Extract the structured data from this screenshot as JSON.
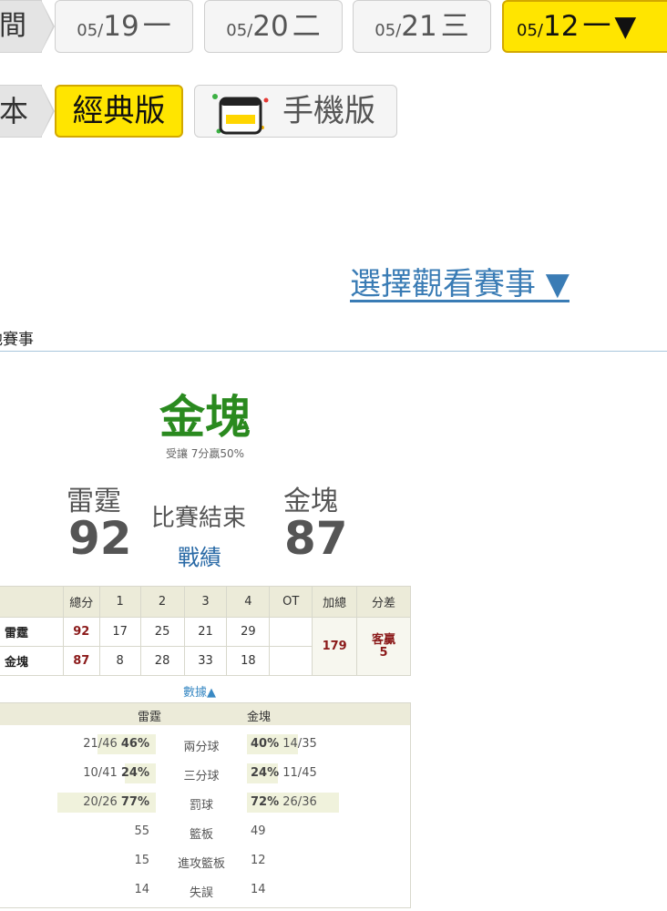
{
  "date_nav": {
    "label": "間",
    "dates": [
      {
        "md": "05/",
        "day": "19",
        "weekday": "一"
      },
      {
        "md": "05/",
        "day": "20",
        "weekday": "二"
      },
      {
        "md": "05/",
        "day": "21",
        "weekday": "三"
      }
    ],
    "selected": {
      "md": "05/",
      "day": "12",
      "weekday": "一",
      "arrow": "▼"
    }
  },
  "version_nav": {
    "label": "本",
    "classic": "經典版",
    "mobile": "手機版"
  },
  "select_match": "選擇觀看賽事 ▼",
  "other_games": "他賽事",
  "game": {
    "winner": "金塊",
    "handicap_note": "受讓 7分贏50%",
    "away_name": "雷霆",
    "away_score": "92",
    "home_name": "金塊",
    "home_score": "87",
    "status": "比賽結束",
    "record_link": "戰績"
  },
  "quarter_table": {
    "headers": [
      "總分",
      "1",
      "2",
      "3",
      "4",
      "OT",
      "加總",
      "分差"
    ],
    "rows": [
      {
        "team": "雷霆",
        "total": "92",
        "q": [
          "17",
          "25",
          "21",
          "29"
        ],
        "ot": ""
      },
      {
        "team": "金塊",
        "total": "87",
        "q": [
          "8",
          "28",
          "33",
          "18"
        ],
        "ot": ""
      }
    ],
    "sum": "179",
    "diff_line1": "客贏",
    "diff_line2": "5"
  },
  "data_toggle": "數據▲",
  "stats": {
    "left_team": "雷霆",
    "right_team": "金塊",
    "rows": [
      {
        "label": "兩分球",
        "left_raw": "21/46",
        "left_pct": "46%",
        "right_pct": "40%",
        "right_raw": "14/35",
        "left_fill": 0.46,
        "right_fill": 0.4
      },
      {
        "label": "三分球",
        "left_raw": "10/41",
        "left_pct": "24%",
        "right_pct": "24%",
        "right_raw": "11/45",
        "left_fill": 0.24,
        "right_fill": 0.24
      },
      {
        "label": "罰球",
        "left_raw": "20/26",
        "left_pct": "77%",
        "right_pct": "72%",
        "right_raw": "26/36",
        "left_fill": 0.77,
        "right_fill": 0.72
      },
      {
        "label": "籃板",
        "left_val": "55",
        "right_val": "49"
      },
      {
        "label": "進攻籃板",
        "left_val": "15",
        "right_val": "12"
      },
      {
        "label": "失誤",
        "left_val": "14",
        "right_val": "14"
      }
    ]
  },
  "colors": {
    "accent_yellow": "#ffe500",
    "winner_green": "#2a8a1f",
    "link_blue": "#3a7cb5",
    "score_red": "#8b1a1a"
  }
}
